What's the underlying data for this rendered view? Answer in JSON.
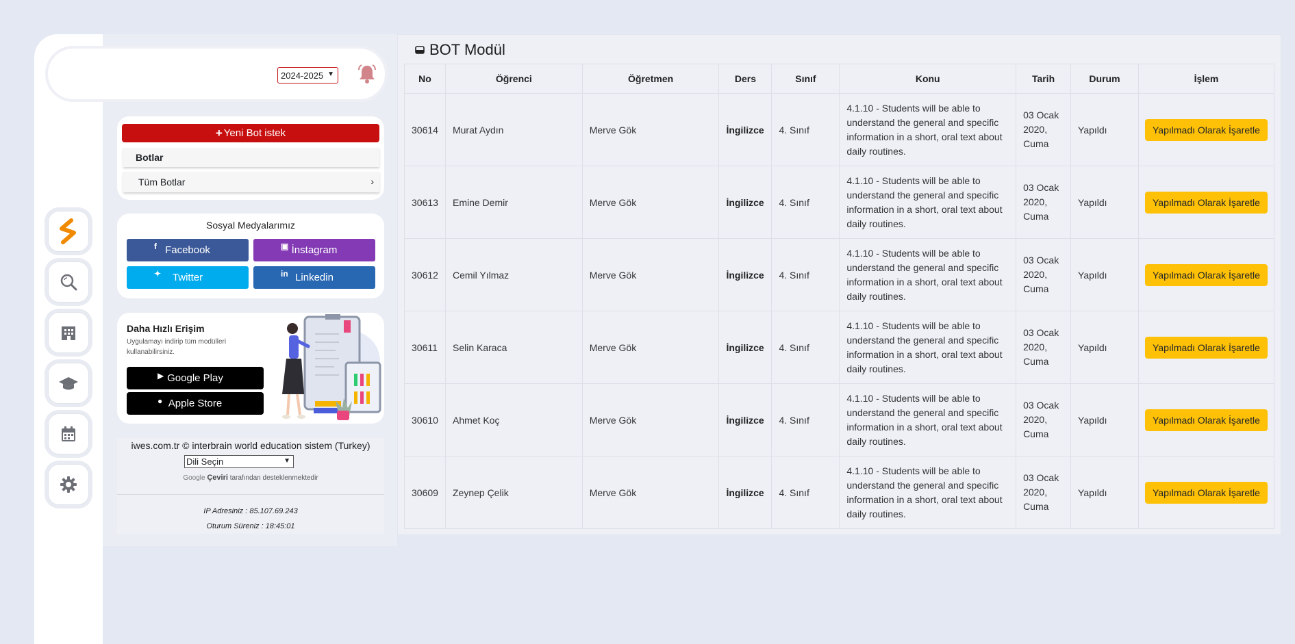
{
  "header": {
    "year_selected": "2024-2025"
  },
  "rail": {
    "icons": [
      "brand-logo-icon",
      "search-icon",
      "building-icon",
      "graduation-cap-icon",
      "calendar-icon",
      "gear-icon"
    ]
  },
  "sidebar": {
    "new_bot_label": "Yeni Bot istek",
    "section_title": "Botlar",
    "items": [
      {
        "label": "Tüm Botlar"
      }
    ],
    "social": {
      "title": "Sosyal Medyalarımız",
      "facebook": "Facebook",
      "instagram": "İnstagram",
      "twitter": "Twitter",
      "linkedin": "Linkedin"
    },
    "app": {
      "title": "Daha Hızlı Erişim",
      "desc": "Uygulamayı indirip tüm modülleri kullanabilirsiniz.",
      "google_play": "Google Play",
      "apple_store": "Apple Store"
    },
    "footer": {
      "copyright": "iwes.com.tr © interbrain world education sistem (Turkey)",
      "language_select": "Dili Seçin",
      "powered_google": "Google",
      "powered_ceviri": "Çeviri",
      "powered_rest": "tarafından desteklenmektedir",
      "ip": "IP Adresiniz : 85.107.69.243",
      "session": "Oturum Süreniz : 18:45:01"
    }
  },
  "main": {
    "title": "BOT Modül",
    "columns": [
      "No",
      "Öğrenci",
      "Öğretmen",
      "Ders",
      "Sınıf",
      "Konu",
      "Tarih",
      "Durum",
      "İşlem"
    ],
    "rows": [
      {
        "no": "30614",
        "ogrenci": "Murat Aydın",
        "ogretmen": "Merve Gök",
        "ders": "İngilizce",
        "sinif": "4. Sınıf",
        "konu": "4.1.10 - Students will be able to understand the general and specific information in a short, oral text about daily routines.",
        "tarih": "03 Ocak 2020, Cuma",
        "durum": "Yapıldı",
        "islem": "Yapılmadı Olarak İşaretle"
      },
      {
        "no": "30613",
        "ogrenci": "Emine Demir",
        "ogretmen": "Merve Gök",
        "ders": "İngilizce",
        "sinif": "4. Sınıf",
        "konu": "4.1.10 - Students will be able to understand the general and specific information in a short, oral text about daily routines.",
        "tarih": "03 Ocak 2020, Cuma",
        "durum": "Yapıldı",
        "islem": "Yapılmadı Olarak İşaretle"
      },
      {
        "no": "30612",
        "ogrenci": "Cemil Yılmaz",
        "ogretmen": "Merve Gök",
        "ders": "İngilizce",
        "sinif": "4. Sınıf",
        "konu": "4.1.10 - Students will be able to understand the general and specific information in a short, oral text about daily routines.",
        "tarih": "03 Ocak 2020, Cuma",
        "durum": "Yapıldı",
        "islem": "Yapılmadı Olarak İşaretle"
      },
      {
        "no": "30611",
        "ogrenci": "Selin Karaca",
        "ogretmen": "Merve Gök",
        "ders": "İngilizce",
        "sinif": "4. Sınıf",
        "konu": "4.1.10 - Students will be able to understand the general and specific information in a short, oral text about daily routines.",
        "tarih": "03 Ocak 2020, Cuma",
        "durum": "Yapıldı",
        "islem": "Yapılmadı Olarak İşaretle"
      },
      {
        "no": "30610",
        "ogrenci": "Ahmet Koç",
        "ogretmen": "Merve Gök",
        "ders": "İngilizce",
        "sinif": "4. Sınıf",
        "konu": "4.1.10 - Students will be able to understand the general and specific information in a short, oral text about daily routines.",
        "tarih": "03 Ocak 2020, Cuma",
        "durum": "Yapıldı",
        "islem": "Yapılmadı Olarak İşaretle"
      },
      {
        "no": "30609",
        "ogrenci": "Zeynep Çelik",
        "ogretmen": "Merve Gök",
        "ders": "İngilizce",
        "sinif": "4. Sınıf",
        "konu": "4.1.10 - Students will be able to understand the general and specific information in a short, oral text about daily routines.",
        "tarih": "03 Ocak 2020, Cuma",
        "durum": "Yapıldı",
        "islem": "Yapılmadı Olarak İşaretle"
      }
    ]
  },
  "colors": {
    "accent_red": "#c80f0f",
    "action_yellow": "#ffc107",
    "facebook": "#3b5998",
    "instagram": "#833ab4",
    "twitter": "#00acee",
    "linkedin": "#2867b2"
  }
}
